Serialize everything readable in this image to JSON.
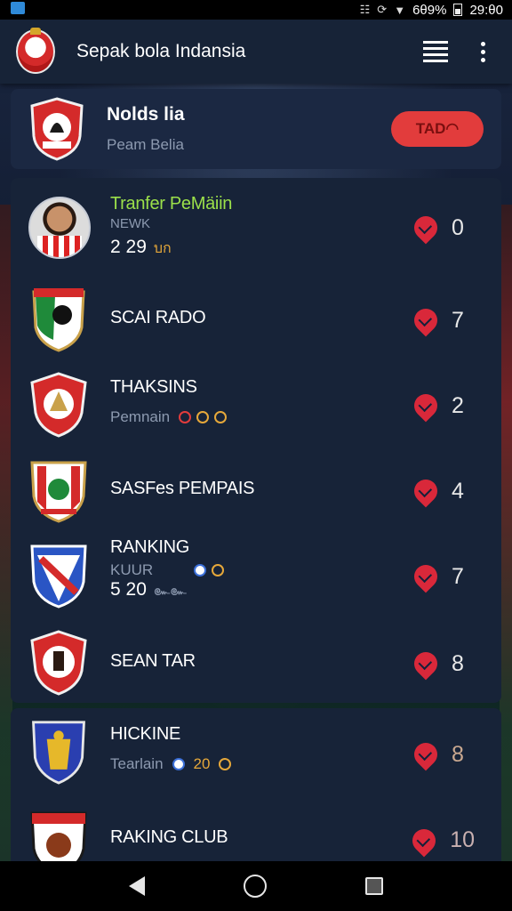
{
  "status_bar": {
    "battery_text": "6θ9%",
    "time": "29:θ0"
  },
  "app_bar": {
    "title": "Sepak bola Indansia"
  },
  "header": {
    "title": "Nolds lia",
    "subtitle": "Peam Belia",
    "pill_label": "TAD◠"
  },
  "rows": [
    {
      "title": "Tranfer PeMäiin",
      "line2": "NEWK",
      "value": "2 29",
      "tag": "บก",
      "count": "0"
    },
    {
      "title": "SCAI RADO",
      "count": "7"
    },
    {
      "title": "THAKSINS",
      "subtitle": "Pemnain",
      "count": "2"
    },
    {
      "title": "SASFes PEMPAIS",
      "count": "4"
    },
    {
      "title": "RANKING",
      "line2": "KUUR",
      "value": "5 20",
      "tag": "๛๛",
      "count": "7"
    },
    {
      "title": "SEAN TAR",
      "count": "8"
    },
    {
      "title": "HICKINE",
      "subtitle": "Tearlain",
      "extra": "20",
      "count": "8"
    },
    {
      "title": "RAKING CLUB",
      "count": "10"
    }
  ],
  "colors": {
    "accent_red": "#e23c3c",
    "highlight_green": "#9be04a",
    "card_bg": "#172338"
  },
  "icons": {
    "menu": "hamburger-icon",
    "more": "more-vert-icon",
    "favorite": "heart-pin-icon"
  }
}
